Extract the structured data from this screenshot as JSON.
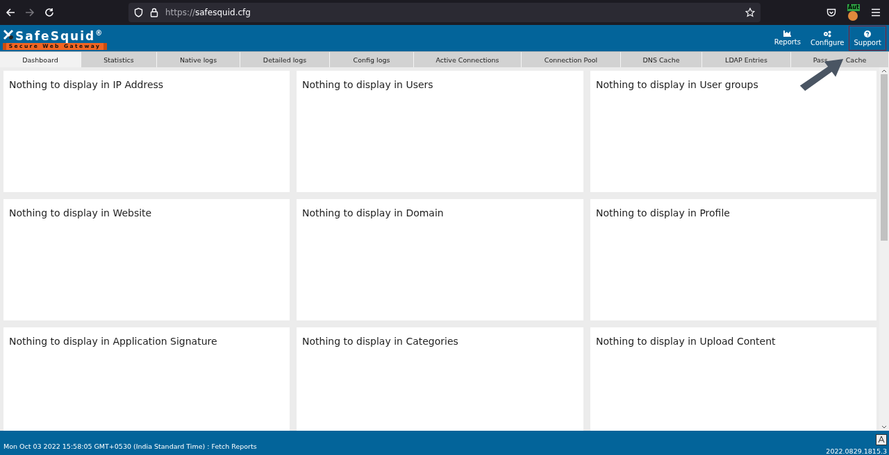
{
  "browser": {
    "url_prefix": "https://",
    "url_host": "safesquid.cfg",
    "extension_badge": "Aut"
  },
  "header": {
    "logo": "SafeSquid",
    "logo_mark": "®",
    "tagline": "Secure Web Gateway",
    "actions": [
      {
        "label": "Reports",
        "kind": "chart",
        "highlighted": false
      },
      {
        "label": "Configure",
        "kind": "gears",
        "highlighted": false
      },
      {
        "label": "Support",
        "kind": "help",
        "highlighted": true
      }
    ]
  },
  "tabs": [
    {
      "label": "Dashboard",
      "selected": true
    },
    {
      "label": "Statistics",
      "selected": false
    },
    {
      "label": "Native logs",
      "selected": false
    },
    {
      "label": "Detailed logs",
      "selected": false
    },
    {
      "label": "Config logs",
      "selected": false
    },
    {
      "label": "Active Connections",
      "selected": false
    },
    {
      "label": "Connection Pool",
      "selected": false
    },
    {
      "label": "DNS Cache",
      "selected": false
    },
    {
      "label": "LDAP Entries",
      "selected": false
    },
    {
      "label": "Pass",
      "label_2": "Cache",
      "selected": false
    }
  ],
  "panels": [
    {
      "message": "Nothing to display in IP Address"
    },
    {
      "message": "Nothing to display in Users"
    },
    {
      "message": "Nothing to display in User groups"
    },
    {
      "message": "Nothing to display in Website"
    },
    {
      "message": "Nothing to display in Domain"
    },
    {
      "message": "Nothing to display in Profile"
    },
    {
      "message": "Nothing to display in Application Signature"
    },
    {
      "message": "Nothing to display in Categories"
    },
    {
      "message": "Nothing to display in Upload Content"
    }
  ],
  "status_bar": {
    "text": "Mon Oct 03 2022 15:58:05 GMT+0530 (India Standard Time) : Fetch Reports",
    "version": "2022.0829.1815.3"
  }
}
